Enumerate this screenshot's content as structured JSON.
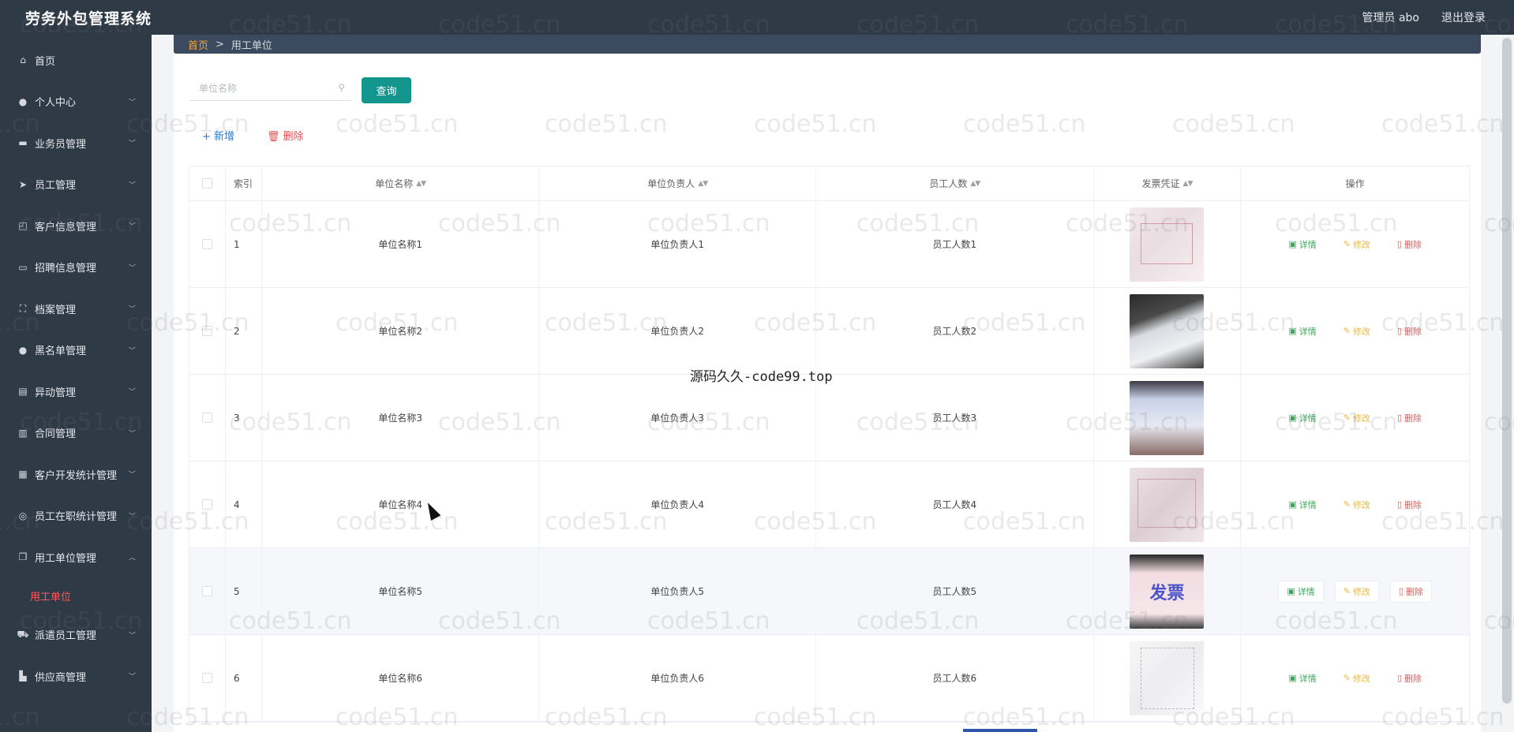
{
  "header": {
    "app_title": "劳务外包管理系统",
    "user_label": "管理员 abo",
    "logout_label": "退出登录"
  },
  "sidebar": {
    "items": [
      {
        "label": "首页",
        "icon": "home-icon",
        "has_children": false
      },
      {
        "label": "个人中心",
        "icon": "user-icon",
        "has_children": true
      },
      {
        "label": "业务员管理",
        "icon": "chat-icon",
        "has_children": true
      },
      {
        "label": "员工管理",
        "icon": "send-icon",
        "has_children": true
      },
      {
        "label": "客户信息管理",
        "icon": "crop-icon",
        "has_children": true
      },
      {
        "label": "招聘信息管理",
        "icon": "message-icon",
        "has_children": true
      },
      {
        "label": "档案管理",
        "icon": "fullscreen-icon",
        "has_children": true
      },
      {
        "label": "黑名单管理",
        "icon": "user-solid-icon",
        "has_children": true
      },
      {
        "label": "异动管理",
        "icon": "notebook-icon",
        "has_children": true
      },
      {
        "label": "合同管理",
        "icon": "data-icon",
        "has_children": true
      },
      {
        "label": "客户开发统计管理",
        "icon": "grid-icon",
        "has_children": true
      },
      {
        "label": "员工在职统计管理",
        "icon": "compass-icon",
        "has_children": true
      },
      {
        "label": "用工单位管理",
        "icon": "copy-icon",
        "has_children": true,
        "expanded": true
      },
      {
        "label": "派遣员工管理",
        "icon": "truck-icon",
        "has_children": true
      },
      {
        "label": "供应商管理",
        "icon": "shop-icon",
        "has_children": true
      }
    ],
    "active_sub": "用工单位"
  },
  "breadcrumb": {
    "home": "首页",
    "separator": ">",
    "current": "用工单位"
  },
  "search": {
    "placeholder": "单位名称",
    "query_label": "查询"
  },
  "toolbar": {
    "add_label": "+ 新增",
    "delete_label": "删除"
  },
  "table": {
    "columns": [
      "索引",
      "单位名称",
      "单位负责人",
      "员工人数",
      "发票凭证",
      "操作"
    ],
    "rows": [
      {
        "index": "1",
        "name": "单位名称1",
        "manager": "单位负责人1",
        "count": "员工人数1"
      },
      {
        "index": "2",
        "name": "单位名称2",
        "manager": "单位负责人2",
        "count": "员工人数2"
      },
      {
        "index": "3",
        "name": "单位名称3",
        "manager": "单位负责人3",
        "count": "员工人数3"
      },
      {
        "index": "4",
        "name": "单位名称4",
        "manager": "单位负责人4",
        "count": "员工人数4"
      },
      {
        "index": "5",
        "name": "单位名称5",
        "manager": "单位负责人5",
        "count": "员工人数5"
      },
      {
        "index": "6",
        "name": "单位名称6",
        "manager": "单位负责人6",
        "count": "员工人数6"
      }
    ],
    "actions": {
      "detail": "详情",
      "edit": "修改",
      "remove": "删除"
    },
    "invoice_thumb_text": "发票"
  },
  "watermark": {
    "text": "code51.cn",
    "center_text": "源码久久-code99.top"
  },
  "colors": {
    "sidebar_bg": "#2f3a47",
    "accent": "#13968e",
    "active_menu": "#ff5a5a",
    "detail": "#39a85b",
    "edit": "#e8b93c",
    "delete": "#e05a5a"
  }
}
